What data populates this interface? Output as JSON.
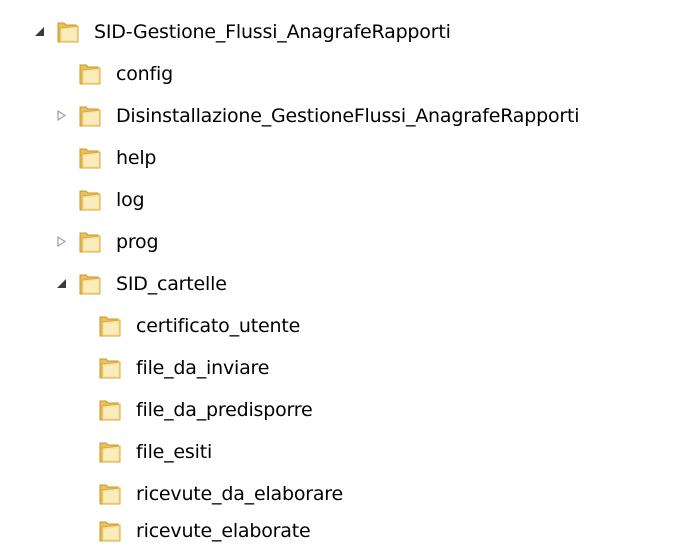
{
  "tree": {
    "items": [
      {
        "label": "SID-Gestione_Flussi_AnagrafeRapporti",
        "expander": "expanded"
      },
      {
        "label": "config",
        "expander": "none"
      },
      {
        "label": "Disinstallazione_GestioneFlussi_AnagrafeRapporti",
        "expander": "collapsed"
      },
      {
        "label": "help",
        "expander": "none"
      },
      {
        "label": "log",
        "expander": "none"
      },
      {
        "label": "prog",
        "expander": "collapsed"
      },
      {
        "label": "SID_cartelle",
        "expander": "expanded"
      },
      {
        "label": "certificato_utente",
        "expander": "none"
      },
      {
        "label": "file_da_inviare",
        "expander": "none"
      },
      {
        "label": "file_da_predisporre",
        "expander": "none"
      },
      {
        "label": "file_esiti",
        "expander": "none"
      },
      {
        "label": "ricevute_da_elaborare",
        "expander": "none"
      },
      {
        "label": "ricevute_elaborate",
        "expander": "none"
      }
    ]
  },
  "icons": {
    "folder": "folder-icon",
    "expanded": "expanded-triangle-icon",
    "collapsed": "collapsed-triangle-icon"
  },
  "colors": {
    "folder_light": "#f7e4a0",
    "folder_mid": "#e9c25b",
    "folder_dark": "#c9962a",
    "expanded_arrow": "#3a3a3a",
    "collapsed_arrow": "#a0a0a0"
  }
}
